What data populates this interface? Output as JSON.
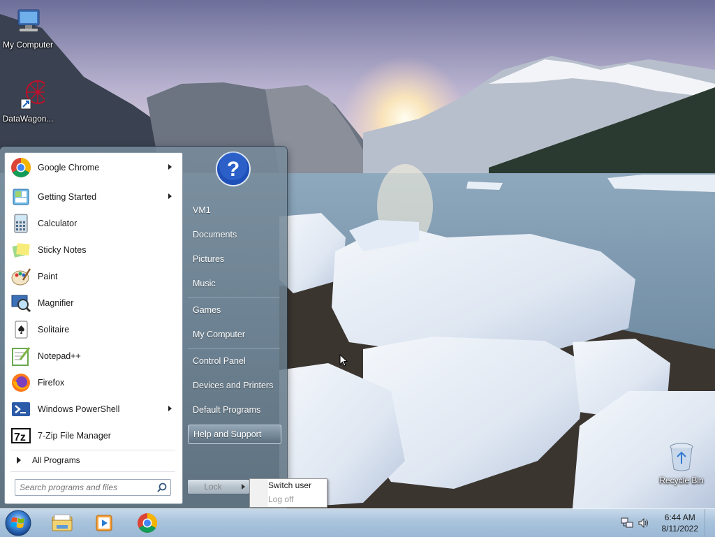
{
  "desktop": {
    "icons": [
      {
        "label": "My Computer"
      },
      {
        "label": "DataWagon..."
      },
      {
        "label": "Recycle Bin"
      }
    ]
  },
  "start_menu": {
    "programs": [
      {
        "label": "Google Chrome",
        "icon": "chrome-icon",
        "has_submenu": true
      },
      {
        "label": "Getting Started",
        "icon": "getting-started-icon",
        "has_submenu": true
      },
      {
        "label": "Calculator",
        "icon": "calculator-icon",
        "has_submenu": false
      },
      {
        "label": "Sticky Notes",
        "icon": "sticky-notes-icon",
        "has_submenu": false
      },
      {
        "label": "Paint",
        "icon": "paint-icon",
        "has_submenu": false
      },
      {
        "label": "Magnifier",
        "icon": "magnifier-icon",
        "has_submenu": false
      },
      {
        "label": "Solitaire",
        "icon": "solitaire-icon",
        "has_submenu": false
      },
      {
        "label": "Notepad++",
        "icon": "notepadpp-icon",
        "has_submenu": false
      },
      {
        "label": "Firefox",
        "icon": "firefox-icon",
        "has_submenu": false
      },
      {
        "label": "Windows PowerShell",
        "icon": "powershell-icon",
        "has_submenu": true
      },
      {
        "label": "7-Zip File Manager",
        "icon": "7zip-icon",
        "has_submenu": false
      }
    ],
    "all_programs_label": "All Programs",
    "search_placeholder": "Search programs and files",
    "right_items": [
      {
        "label": "VM1"
      },
      {
        "label": "Documents"
      },
      {
        "label": "Pictures"
      },
      {
        "label": "Music"
      },
      {
        "label": "Games"
      },
      {
        "label": "My Computer"
      },
      {
        "label": "Control Panel"
      },
      {
        "label": "Devices and Printers"
      },
      {
        "label": "Default Programs"
      },
      {
        "label": "Help and Support"
      }
    ],
    "highlighted_item": "Help and Support",
    "lock_label": "Lock",
    "power_menu": {
      "switch_user": "Switch user",
      "log_off": "Log off"
    }
  },
  "taskbar": {
    "pinned": [
      "windows-explorer-icon",
      "media-player-icon",
      "chrome-icon"
    ],
    "clock_time": "6:44 AM",
    "clock_date": "8/11/2022"
  },
  "colors": {
    "taskbar": "#a9c3dc",
    "start_menu_right": "#6e8494",
    "help_icon_blue": "#1f4fb8"
  }
}
